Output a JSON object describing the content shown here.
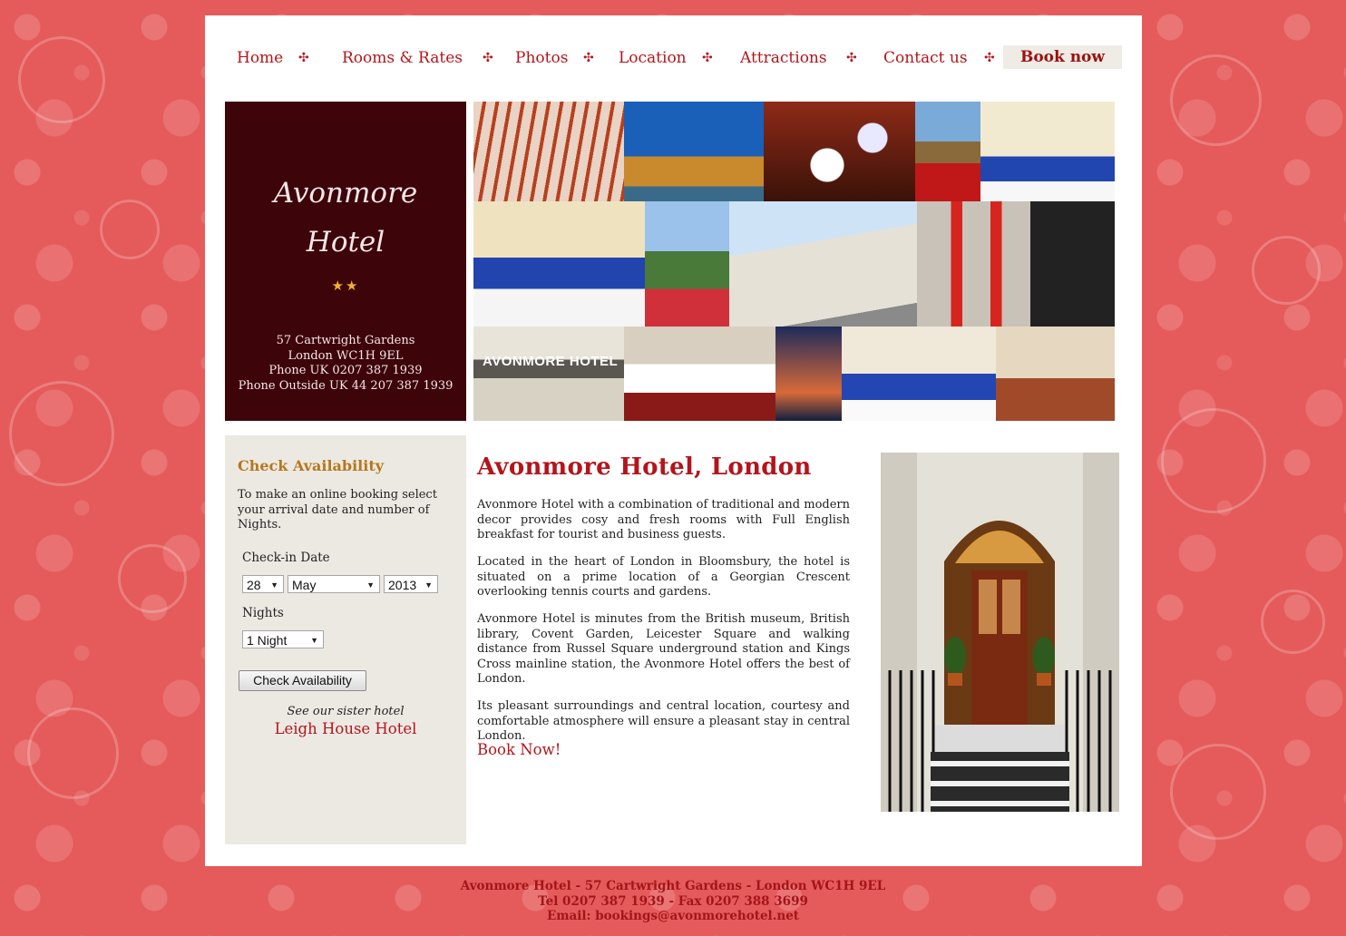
{
  "nav": {
    "items": [
      "Home",
      "Rooms & Rates",
      "Photos",
      "Location",
      "Attractions",
      "Contact us"
    ],
    "separator": "✣",
    "book_now": "Book now"
  },
  "brand": {
    "name_line1": "Avonmore",
    "name_line2": "Hotel",
    "stars": "★★",
    "address_line1": "57 Cartwright Gardens",
    "address_line2": "London WC1H 9EL",
    "phone_uk": "Phone UK 0207 387 1939",
    "phone_outside": "Phone Outside UK 44 207 387 1939"
  },
  "photo_collage": {
    "sign_text": "AVONMORE HOTEL"
  },
  "availability": {
    "title": "Check Availability",
    "intro": "To make an online booking select your arrival date and number of Nights.",
    "checkin_label": "Check-in Date",
    "day": "28",
    "month": "May",
    "year": "2013",
    "nights_label": "Nights",
    "nights": "1 Night",
    "button": "Check Availability",
    "sister_text": "See our sister hotel",
    "sister_link": "Leigh House Hotel"
  },
  "main": {
    "title": "Avonmore Hotel, London",
    "paragraphs": [
      "Avonmore Hotel with a combination of traditional and modern decor provides cosy and fresh rooms with Full English breakfast for tourist and business guests.",
      "Located in the heart of London in Bloomsbury, the hotel is situated on a prime location of a Georgian Crescent overlooking tennis courts and gardens.",
      "Avonmore Hotel is minutes from the British museum, British library, Covent Garden, Leicester Square and walking distance from Russel Square underground station and Kings Cross mainline station, the Avonmore Hotel offers the best of London.",
      "Its pleasant surroundings and central location, courtesy and comfortable atmosphere will ensure a pleasant stay in central London."
    ],
    "book_link": "Book Now!"
  },
  "footer": {
    "line1": "Avonmore Hotel - 57 Cartwright Gardens - London WC1H 9EL",
    "line2": "Tel 0207 387 1939 - Fax 0207 388 3699",
    "line3": "Email: bookings@avonmorehotel.net"
  },
  "colors": {
    "background": "#e55a5a",
    "accent_red": "#b3151a",
    "brand_panel": "#3d040a",
    "sidebar": "#ece9e3",
    "gold_heading": "#b7771b"
  }
}
